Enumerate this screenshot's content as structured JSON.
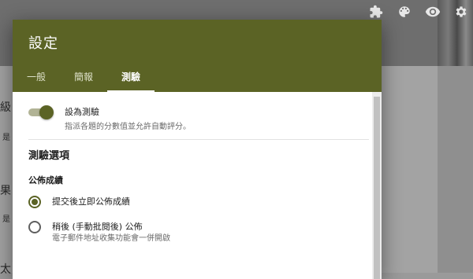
{
  "background": {
    "left_fragments": [
      "級",
      "是",
      "果",
      "是",
      "太"
    ]
  },
  "toolbar_icons": [
    "puzzle-icon",
    "palette-icon",
    "eye-icon",
    "gear-icon"
  ],
  "dialog": {
    "title": "設定",
    "tabs": [
      {
        "label": "一般",
        "active": false
      },
      {
        "label": "簡報",
        "active": false
      },
      {
        "label": "測驗",
        "active": true
      }
    ],
    "quiz_toggle": {
      "label": "設為測驗",
      "description": "指派各題的分數值並允許自動評分。",
      "enabled": true
    },
    "section_title": "測驗選項",
    "release_grade": {
      "title": "公佈成績",
      "options": [
        {
          "label": "提交後立即公佈成績",
          "description": "",
          "checked": true
        },
        {
          "label": "稍後 (手動批閱後) 公佈",
          "description": "電子郵件地址收集功能會一併開啟",
          "checked": false
        }
      ]
    }
  },
  "colors": {
    "header": "#5b6325",
    "accent": "#5b6325"
  }
}
